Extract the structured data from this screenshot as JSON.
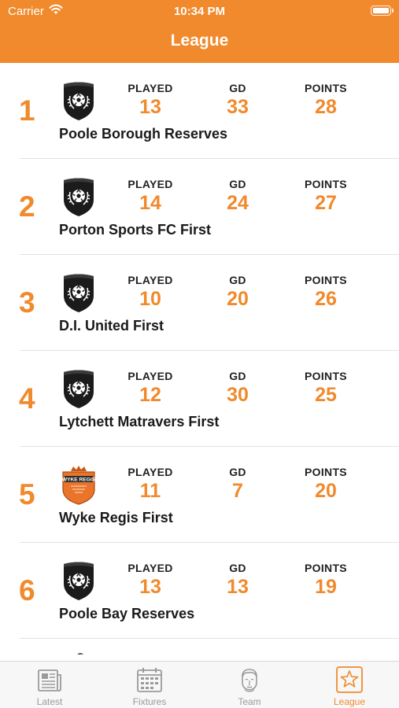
{
  "status_bar": {
    "carrier": "Carrier",
    "time": "10:34 PM"
  },
  "nav": {
    "title": "League"
  },
  "stat_labels": {
    "played": "PLAYED",
    "gd": "GD",
    "points": "POINTS"
  },
  "rows": [
    {
      "rank": "1",
      "team": "Poole Borough Reserves",
      "played": "13",
      "gd": "33",
      "points": "28",
      "badge": "black-shield-badge"
    },
    {
      "rank": "2",
      "team": "Porton Sports FC First",
      "played": "14",
      "gd": "24",
      "points": "27",
      "badge": "black-shield-badge"
    },
    {
      "rank": "3",
      "team": "D.I. United First",
      "played": "10",
      "gd": "20",
      "points": "26",
      "badge": "black-shield-badge"
    },
    {
      "rank": "4",
      "team": "Lytchett Matravers First",
      "played": "12",
      "gd": "30",
      "points": "25",
      "badge": "black-shield-badge"
    },
    {
      "rank": "5",
      "team": "Wyke Regis First",
      "played": "11",
      "gd": "7",
      "points": "20",
      "badge": "wyke-regis-badge",
      "badge_text": "WYKE REGIS"
    },
    {
      "rank": "6",
      "team": "Poole Bay Reserves",
      "played": "13",
      "gd": "13",
      "points": "19",
      "badge": "black-shield-badge"
    }
  ],
  "tabs": [
    {
      "label": "Latest",
      "icon": "newspaper-icon",
      "active": false
    },
    {
      "label": "Fixtures",
      "icon": "calendar-icon",
      "active": false
    },
    {
      "label": "Team",
      "icon": "player-face-icon",
      "active": false
    },
    {
      "label": "League",
      "icon": "star-icon",
      "active": true
    }
  ],
  "colors": {
    "accent": "#f08a2c",
    "tab_inactive": "#9a9a9a",
    "text": "#1a1a1a"
  }
}
